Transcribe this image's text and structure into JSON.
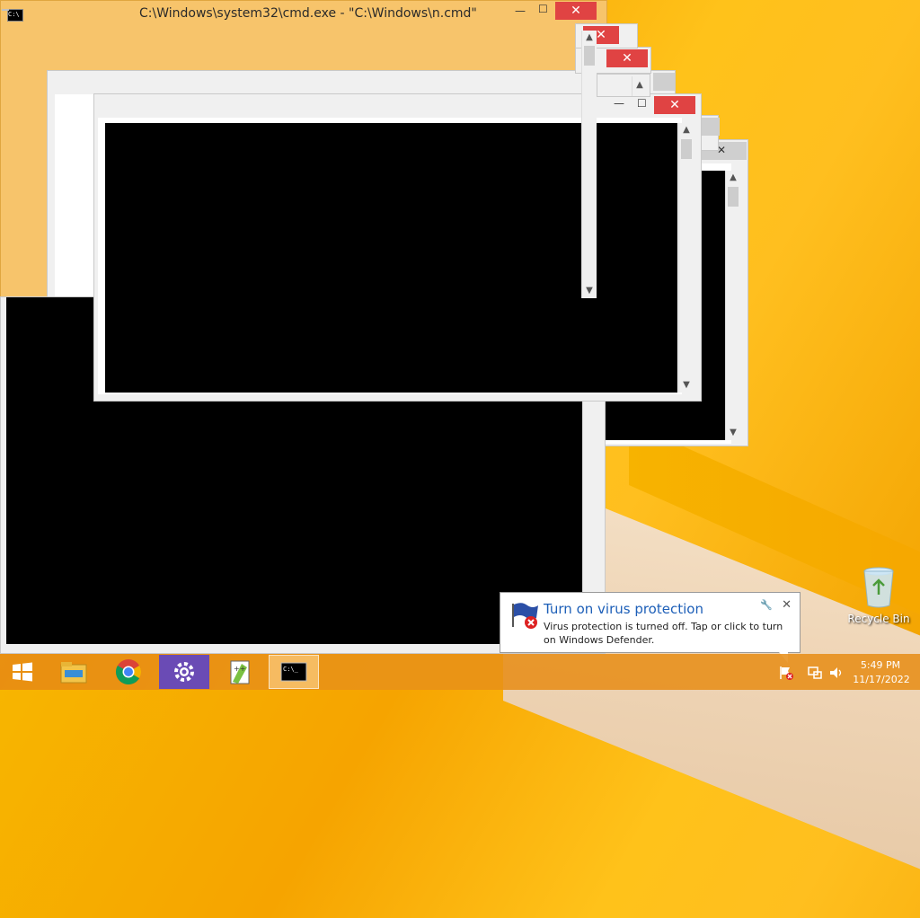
{
  "front_window": {
    "title": "C:\\Windows\\system32\\cmd.exe - \"C:\\Windows\\n.cmd\"",
    "icon_text": "C:\\",
    "close_label": "✕",
    "minimize_label": "—",
    "maximize_label": "☐"
  },
  "background_windows": {
    "close_label": "✕"
  },
  "notification": {
    "title": "Turn on virus protection",
    "body": "Virus protection is turned off. Tap or click to turn on Windows Defender.",
    "close_label": "✕"
  },
  "desktop": {
    "recycle_bin_label": "Recycle Bin"
  },
  "taskbar": {
    "items": [
      "start",
      "file-explorer",
      "chrome",
      "settings",
      "notepad-plus-plus",
      "cmd"
    ],
    "clock_time": "5:49 PM",
    "clock_date": "11/17/2022"
  },
  "colors": {
    "accent": "#f7c46b",
    "close_red": "#e04343",
    "notification_title": "#1d5fb8"
  }
}
